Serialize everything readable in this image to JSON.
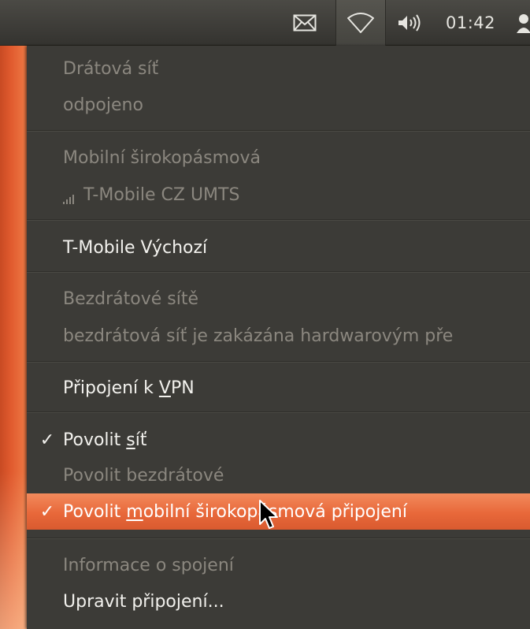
{
  "panel": {
    "clock": "01:42",
    "icons": [
      "mail-icon",
      "network-wireless-icon",
      "volume-icon",
      "user-icon"
    ]
  },
  "menu": {
    "wired_title": "Drátová síť",
    "wired_status": "odpojeno",
    "mobile_title": "Mobilní širokopásmová",
    "mobile_network": "T-Mobile CZ UMTS",
    "mobile_default": "T-Mobile Výchozí",
    "wireless_title": "Bezdrátové sítě",
    "wireless_status": "bezdrátová síť je zakázána hardwarovým pře",
    "vpn_prefix": "Připojení k ",
    "vpn_mnemonic": "V",
    "vpn_suffix": "PN",
    "enable_network_prefix": "Povolit ",
    "enable_network_mnemonic": "s",
    "enable_network_suffix": "íť",
    "enable_network_check": "✓",
    "enable_wireless": "Povolit bezdrátové",
    "enable_mobile_prefix": "Povolit ",
    "enable_mobile_mnemonic": "m",
    "enable_mobile_suffix": "obilní širokopásmová připojení",
    "enable_mobile_check": "✓",
    "connection_info": "Informace o spojení",
    "edit_connections": "Upravit připojení..."
  },
  "colors": {
    "menu_bg": "#3c3b37",
    "highlight": "#e8683a",
    "disabled_text": "#8b877f",
    "enabled_text": "#f2f1ed"
  }
}
